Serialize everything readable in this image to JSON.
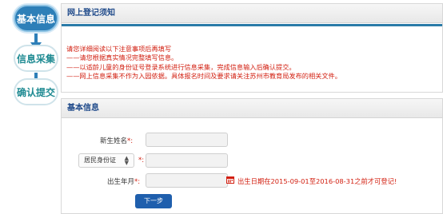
{
  "steps": [
    {
      "label": "基本信息",
      "state": "active"
    },
    {
      "label": "信息采集",
      "state": "pending"
    },
    {
      "label": "确认提交",
      "state": "pending"
    }
  ],
  "notice": {
    "title": "网上登记须知",
    "lines": [
      "请您详细阅读以下注意事项后再填写",
      "——请您根据真实情况完整填写信息。",
      "——以适龄儿童的身份证号登录系统进行信息采集，完成信息输入后确认提交。",
      "——网上信息采集不作为入园依据。具体报名时间及要求请关注苏州市教育局发布的相关文件。"
    ]
  },
  "basic_info": {
    "title": "基本信息",
    "name_label": "新生姓名",
    "id_type_value": "居民身份证",
    "birth_label": "出生年月",
    "required_mark": "*:",
    "birth_hint": "出生日期在2015-09-01至2016-08-31之前才可登记!",
    "next_button": "下一步"
  },
  "colors": {
    "accent": "#2d7fb8",
    "warning_text": "#d21e0f",
    "button": "#1f5fad"
  }
}
